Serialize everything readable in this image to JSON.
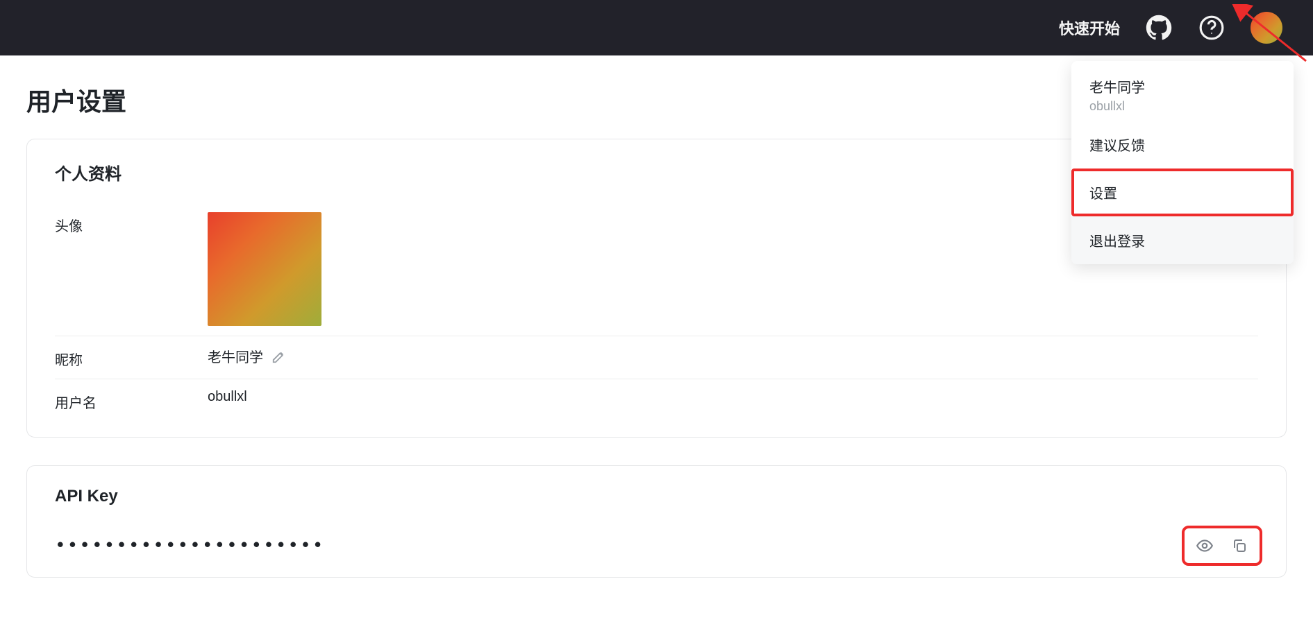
{
  "header": {
    "quick_start": "快速开始"
  },
  "dropdown": {
    "display_name": "老牛同学",
    "username": "obullxl",
    "feedback": "建议反馈",
    "settings": "设置",
    "logout": "退出登录"
  },
  "page": {
    "title": "用户设置"
  },
  "profile": {
    "section_title": "个人资料",
    "avatar_label": "头像",
    "nickname_label": "昵称",
    "nickname_value": "老牛同学",
    "username_label": "用户名",
    "username_value": "obullxl"
  },
  "api": {
    "section_title": "API Key",
    "masked_value": "••••••••••••••••••••••"
  }
}
